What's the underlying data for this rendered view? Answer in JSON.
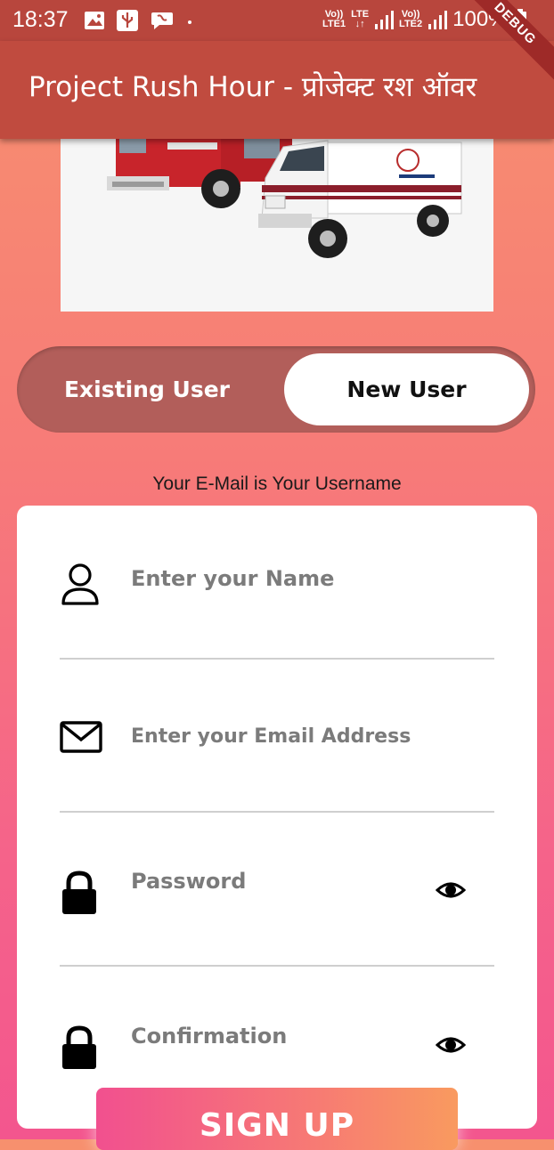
{
  "status_bar": {
    "time": "18:37",
    "sim1_top": "Vo))",
    "sim1_label": "LTE1",
    "lte_label": "LTE",
    "lte_arrows": "↓↑",
    "sim2_top": "Vo))",
    "sim2_label": "LTE2",
    "battery": "100%"
  },
  "app_bar": {
    "title": "Project Rush Hour - प्रोजेक्ट रश ऑवर",
    "debug_banner": "DEBUG"
  },
  "toggle": {
    "existing_label": "Existing User",
    "new_label": "New User",
    "selected": "New User"
  },
  "form": {
    "note": "Your E-Mail is Your Username",
    "name_placeholder": "Enter your Name",
    "email_placeholder": "Enter your Email Address",
    "password_placeholder": "Password",
    "confirmation_placeholder": "Confirmation"
  },
  "signup_label": "SIGN UP",
  "icons": {
    "name": "person-icon",
    "email": "envelope-icon",
    "password": "lock-icon",
    "visibility": "eye-icon"
  },
  "colors": {
    "status_bar": "#b8463d",
    "app_bar": "#c04b3f",
    "toggle_track": "#b25e5a",
    "background_top": "#f7906e",
    "background_bottom": "#f3568e"
  }
}
